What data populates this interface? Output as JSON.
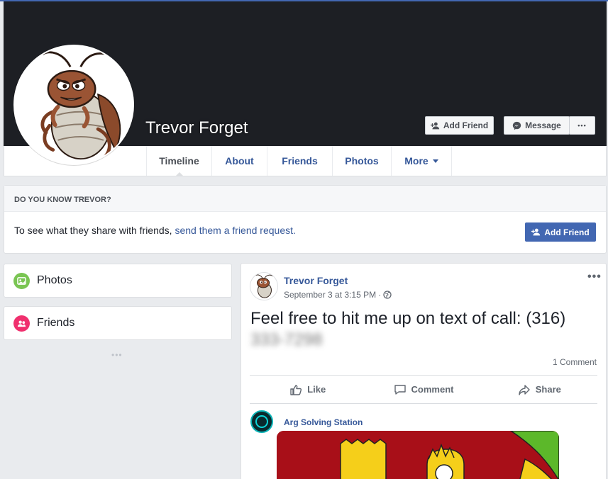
{
  "profile": {
    "name": "Trevor Forget"
  },
  "cover_actions": {
    "add_friend": "Add Friend",
    "message": "Message",
    "more": "•••"
  },
  "nav": {
    "tabs": [
      {
        "label": "Timeline",
        "active": true
      },
      {
        "label": "About"
      },
      {
        "label": "Friends"
      },
      {
        "label": "Photos"
      },
      {
        "label": "More"
      }
    ]
  },
  "know_box": {
    "heading": "DO YOU KNOW TREVOR?",
    "text": "To see what they share with friends, ",
    "link": "send them a friend request.",
    "button": "Add Friend"
  },
  "sidebar": {
    "items": [
      {
        "label": "Photos",
        "icon": "photos-icon",
        "color": "#7ac553"
      },
      {
        "label": "Friends",
        "icon": "friends-icon",
        "color": "#f0306e"
      }
    ],
    "dots": "•••"
  },
  "post": {
    "author": "Trevor Forget",
    "timestamp": "September 3 at 3:15 PM",
    "separator": "·",
    "more": "•••",
    "text": "Feel free to hit me up on text of call: (316)",
    "text_blurred": "333-7298",
    "comment_count": "1 Comment",
    "actions": {
      "like": "Like",
      "comment": "Comment",
      "share": "Share"
    }
  },
  "shared_post": {
    "author": "Arg Solving Station"
  },
  "colors": {
    "brand": "#4267b2",
    "link": "#365899",
    "cover": "#1d1f24",
    "background": "#e9ebee"
  }
}
